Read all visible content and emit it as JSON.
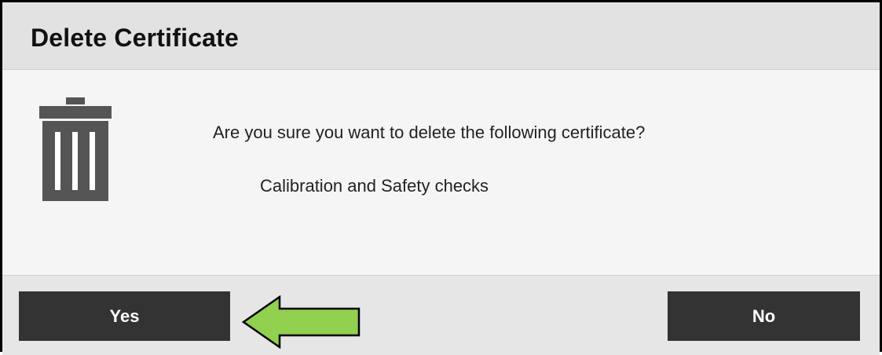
{
  "dialog": {
    "title": "Delete Certificate",
    "icon": "trash-icon",
    "message": "Are you sure you want to delete the following certificate?",
    "certificate_name": "Calibration and Safety checks"
  },
  "buttons": {
    "yes_label": "Yes",
    "no_label": "No"
  },
  "annotation": {
    "icon": "left-arrow-icon",
    "color": "#92d050"
  },
  "colors": {
    "titlebar": "#e2e2e2",
    "button": "#333333",
    "icon": "#555555"
  }
}
